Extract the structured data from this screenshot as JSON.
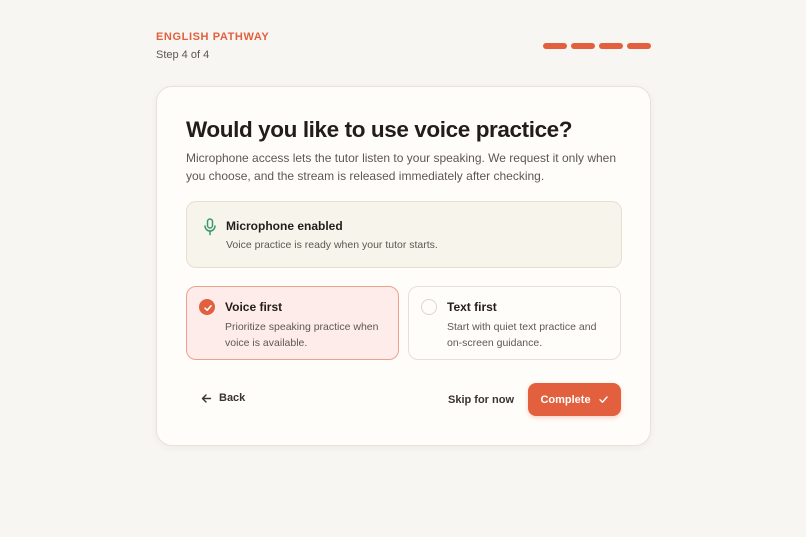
{
  "header": {
    "eyebrow": "ENGLISH PATHWAY",
    "step": "Step 4 of 4",
    "progress": {
      "completed": 4,
      "total": 4
    }
  },
  "card": {
    "title": "Would you like to use voice practice?",
    "description": "Microphone access lets the tutor listen to your speaking. We request it only when you choose, and the stream is released immediately after checking."
  },
  "mic": {
    "icon": "microphone-icon",
    "title": "Microphone enabled",
    "subtitle": "Voice practice is ready when your tutor starts."
  },
  "options": [
    {
      "title": "Voice first",
      "description": "Prioritize speaking practice when voice is available.",
      "selected": true
    },
    {
      "title": "Text first",
      "description": "Start with quiet text practice and on-screen guidance.",
      "selected": false
    }
  ],
  "actions": {
    "back_label": "Back",
    "skip_label": "Skip for now",
    "complete_label": "Complete"
  },
  "colors": {
    "accent": "#e2603e",
    "mic_green": "#3a9a6a",
    "background": "#f8f6f3"
  }
}
